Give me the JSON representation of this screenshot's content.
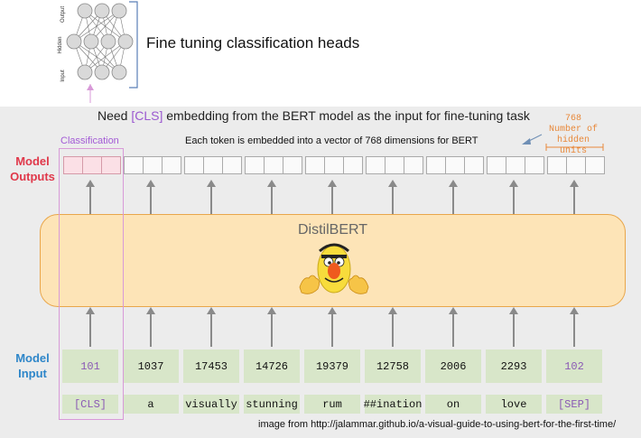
{
  "header": {
    "title": "Fine tuning classification heads",
    "nn_labels": {
      "output": "Output",
      "hidden": "Hidden",
      "input": "Input"
    }
  },
  "annotations": {
    "need_prefix": "Need ",
    "need_cls": "[CLS]",
    "need_suffix": " embedding from the BERT model as the input for fine-tuning task",
    "classification": "Classification",
    "embed_note": "Each token  is embedded into a vector of 768 dimensions for BERT",
    "hidden_count": "768",
    "hidden_units": "Number of hidden units"
  },
  "side_labels": {
    "outputs_line1": "Model",
    "outputs_line2": "Outputs",
    "input_line1": "Model",
    "input_line2": "Input"
  },
  "model": {
    "name": "DistilBERT",
    "mascot": "bert-mascot-icon"
  },
  "tokens": [
    {
      "id": "101",
      "token": "[CLS]",
      "special": true
    },
    {
      "id": "1037",
      "token": "a",
      "special": false
    },
    {
      "id": "17453",
      "token": "visually",
      "special": false
    },
    {
      "id": "14726",
      "token": "stunning",
      "special": false
    },
    {
      "id": "19379",
      "token": "rum",
      "special": false
    },
    {
      "id": "12758",
      "token": "##ination",
      "special": false
    },
    {
      "id": "2006",
      "token": "on",
      "special": false
    },
    {
      "id": "2293",
      "token": "love",
      "special": false
    },
    {
      "id": "102",
      "token": "[SEP]",
      "special": true
    }
  ],
  "credit": "image from http://jalammar.github.io/a-visual-guide-to-using-bert-for-the-first-time/",
  "colors": {
    "accent_red": "#e0384a",
    "accent_blue": "#2e86c9",
    "cls_purple": "#a35bd6",
    "model_fill": "#fde4b7",
    "token_fill": "#d8e6c9",
    "hidden_orange": "#e8883a"
  }
}
